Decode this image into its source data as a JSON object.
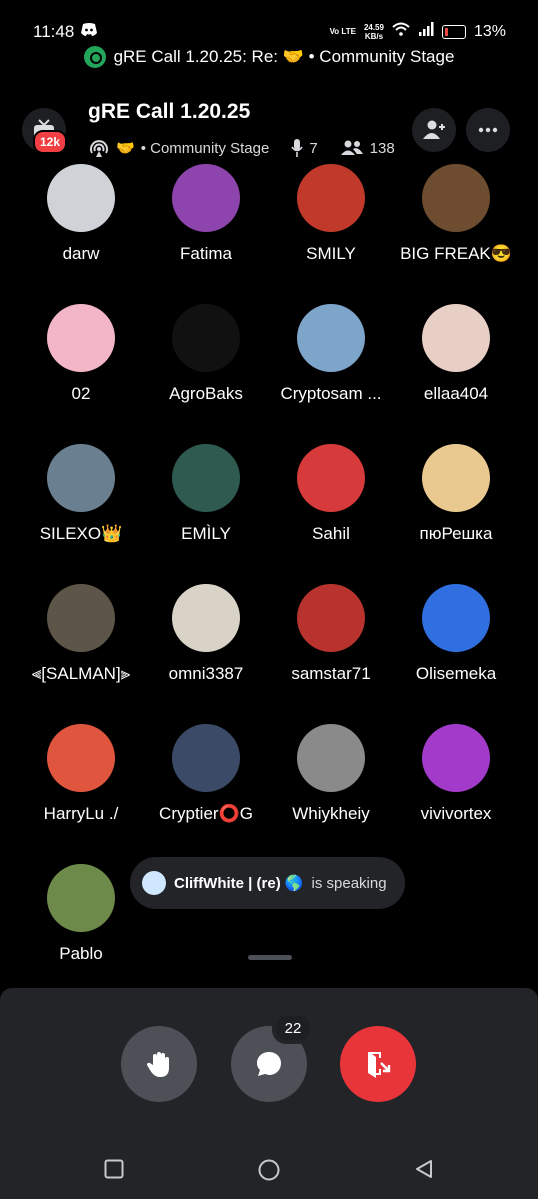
{
  "status_bar": {
    "time": "11:48",
    "network_speed": "24.59",
    "speed_unit": "KB/s",
    "lte": "Vo LTE",
    "battery": "13%"
  },
  "banner": {
    "text": "gRE Call 1.20.25: Re: 🤝 • Community Stage"
  },
  "header": {
    "title": "gRE Call 1.20.25",
    "viewer_badge": "12k",
    "stage_emoji": "🤝",
    "stage_label": "• Community Stage",
    "speaker_count": "7",
    "listener_count": "138"
  },
  "participants": [
    {
      "name": "darw",
      "color": "#cfd3d8"
    },
    {
      "name": "Fatima",
      "color": "#8e44ad"
    },
    {
      "name": "SMILY",
      "color": "#c0392b"
    },
    {
      "name": "BIG FREAK😎",
      "color": "#6d4c2f"
    },
    {
      "name": "02",
      "color": "#f2b6c6"
    },
    {
      "name": "AgroBaks",
      "color": "#111111"
    },
    {
      "name": "Cryptosam ...",
      "color": "#7da4c9"
    },
    {
      "name": "ellaa404",
      "color": "#e8cfc5"
    },
    {
      "name": "SILEXO👑",
      "color": "#6a7f8f"
    },
    {
      "name": "EMÌLY",
      "color": "#2e5a4f"
    },
    {
      "name": "Sahil",
      "color": "#d63a3a"
    },
    {
      "name": "пюРешка",
      "color": "#e9c98f"
    },
    {
      "name": "⫷[SALMAN]⫸",
      "color": "#5d5548"
    },
    {
      "name": "omni3387",
      "color": "#d9d2c6"
    },
    {
      "name": "samstar71",
      "color": "#b8332e"
    },
    {
      "name": "Olisemeka",
      "color": "#2f6fe0"
    },
    {
      "name": "HarryLu ./",
      "color": "#e0553d"
    },
    {
      "name": "Cryptier⭕G",
      "color": "#3b4a66"
    },
    {
      "name": "Whiykheiy",
      "color": "#8a8a8a"
    },
    {
      "name": "vivivortex",
      "color": "#a23bc9"
    },
    {
      "name": "Pablo",
      "color": "#6e8a4a"
    }
  ],
  "speaking": {
    "name": "CliffWhite | (re) 🌎",
    "suffix": "is speaking"
  },
  "controls": {
    "chat_badge": "22"
  },
  "colors": {
    "leave": "#e8353a",
    "panel": "#232428",
    "button": "#4e5058"
  }
}
